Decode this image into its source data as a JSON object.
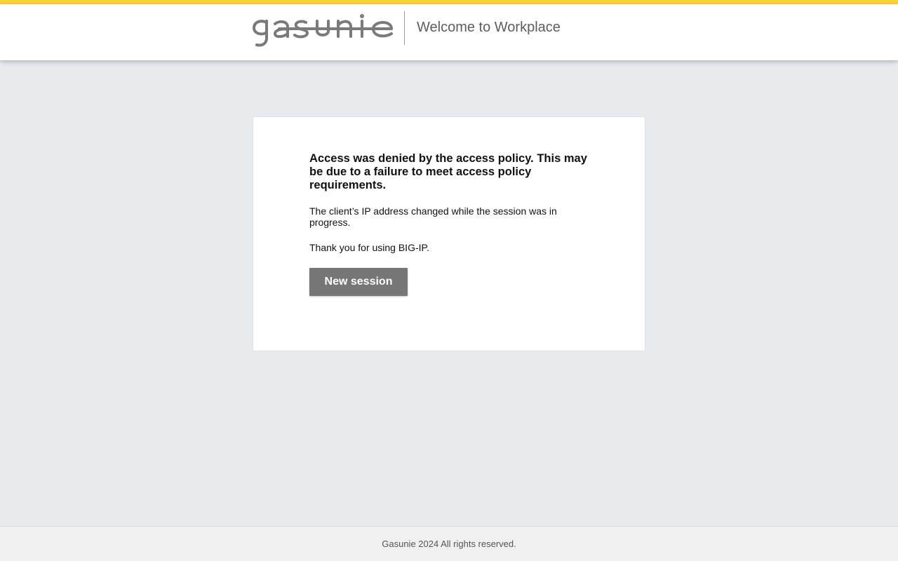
{
  "header": {
    "brand_name": "gasunie",
    "title": "Welcome to Workplace",
    "logo_color": "#7a7a7a",
    "accent_color": "#fcd23c"
  },
  "card": {
    "heading": "Access was denied by the access policy. This may be due to a failure to meet access policy requirements.",
    "message": "The client’s IP address changed while the session was in progress.",
    "thanks": "Thank you for using BIG-IP.",
    "button_label": "New session"
  },
  "footer": {
    "text": "Gasunie 2024 All rights reserved."
  }
}
